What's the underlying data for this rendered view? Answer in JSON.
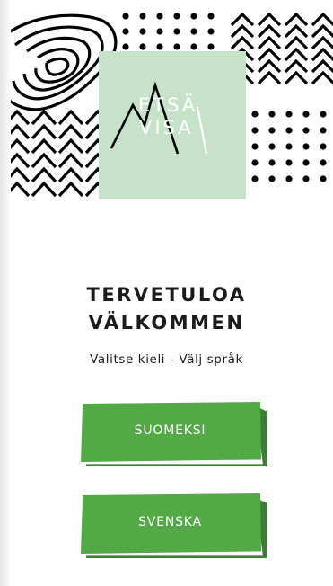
{
  "colors": {
    "logo_background": "#c6e3ca",
    "button": "#52a946",
    "pattern": "#000000"
  },
  "logo": {
    "line1": "ETSÄ",
    "line2": "VISA"
  },
  "welcome": {
    "title_fi": "TERVETULOA",
    "title_sv": "VÄLKOMMEN",
    "subtitle": "Valitse kieli - Välj språk"
  },
  "buttons": {
    "finnish": "SUOMEKSI",
    "swedish": "SVENSKA"
  }
}
